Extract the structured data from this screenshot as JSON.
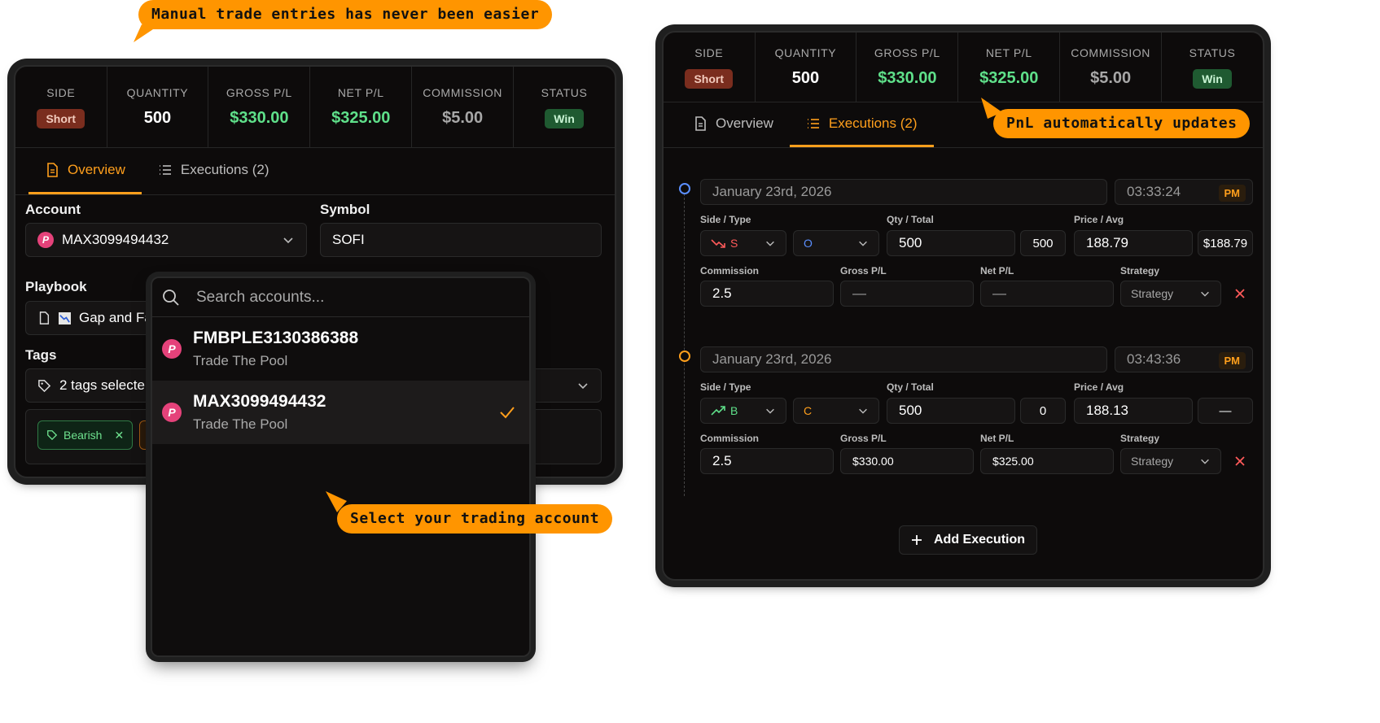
{
  "callouts": {
    "top": "Manual trade entries has never been easier",
    "pnl": "PnL automatically updates",
    "account": "Select your trading account"
  },
  "stats": {
    "side_label": "SIDE",
    "side_value": "Short",
    "qty_label": "QUANTITY",
    "qty_value": "500",
    "gross_label": "GROSS P/L",
    "gross_value": "$330.00",
    "net_label": "NET P/L",
    "net_value": "$325.00",
    "comm_label": "COMMISSION",
    "comm_value": "$5.00",
    "status_label": "STATUS",
    "status_value": "Win"
  },
  "tabs": {
    "overview": "Overview",
    "executions": "Executions (2)"
  },
  "form": {
    "account_label": "Account",
    "account_value": "MAX3099494432",
    "symbol_label": "Symbol",
    "symbol_value": "SOFI",
    "playbook_label": "Playbook",
    "playbook_value": "Gap and Fa",
    "tags_label": "Tags",
    "tags_value": "2 tags selecte",
    "tag_bearish": "Bearish"
  },
  "dropdown": {
    "placeholder": "Search accounts...",
    "options": [
      {
        "name": "FMBPLE3130386388",
        "sub": "Trade The Pool"
      },
      {
        "name": "MAX3099494432",
        "sub": "Trade The Pool"
      }
    ]
  },
  "executions": {
    "labels": {
      "side_type": "Side / Type",
      "qty_total": "Qty / Total",
      "price_avg": "Price / Avg",
      "commission": "Commission",
      "gross": "Gross P/L",
      "net": "Net P/L",
      "strategy": "Strategy"
    },
    "rows": [
      {
        "date": "January 23rd, 2026",
        "time": "03:33:24",
        "ampm": "PM",
        "side": "S",
        "type": "O",
        "qty": "500",
        "total": "500",
        "price": "188.79",
        "avg": "$188.79",
        "commission": "2.5",
        "gross": "—",
        "net": "—",
        "strategy": "Strategy"
      },
      {
        "date": "January 23rd, 2026",
        "time": "03:43:36",
        "ampm": "PM",
        "side": "B",
        "type": "C",
        "qty": "500",
        "total": "0",
        "price": "188.13",
        "avg": "—",
        "commission": "2.5",
        "gross": "$330.00",
        "net": "$325.00",
        "strategy": "Strategy"
      }
    ],
    "add_label": "Add Execution"
  },
  "colors": {
    "accent": "#ff9f1c",
    "green": "#5fe08a",
    "red": "#ff5a5a",
    "blue": "#5b8fff",
    "callout": "#ff9500"
  }
}
